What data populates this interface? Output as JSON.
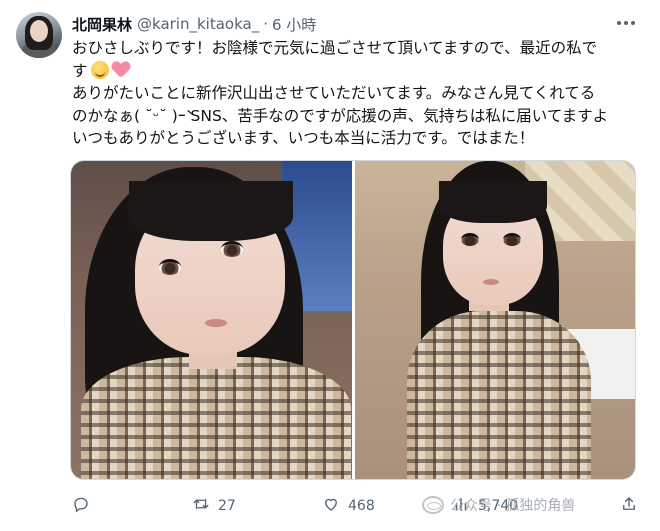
{
  "author": {
    "display_name": "北岡果林",
    "handle": "@karin_kitaoka_",
    "separator": "·",
    "time": "6 小時"
  },
  "tweet": {
    "lines": [
      "おひさしぶりです！お陰様で元気に過ごさせて頂いてますので、最近の私で",
      "す",
      "ありがたいことに新作沢山出させていただいてます。みなさん見てくれてる",
      "のかなぁ( ˘ᵕ˘ )ｰ̀ SNS、苦手なのですが応援の声、気持ちは私に届いてますよ",
      "いつもありがとうございます、いつも本当に活力です。ではまた！"
    ],
    "emojis": [
      "relieved-face-emoji",
      "pink-heart-emoji"
    ]
  },
  "media": {
    "photos": [
      "photo-left",
      "photo-right"
    ]
  },
  "actions": {
    "reply_count": "",
    "retweet_count": "27",
    "like_count": "468",
    "views_count": "5,740"
  },
  "watermark": {
    "text": "公众号 · 孤独的角兽"
  },
  "icons": {
    "reply": "reply-icon",
    "retweet": "retweet-icon",
    "like": "heart-icon",
    "views": "views-chart-icon",
    "share": "share-icon",
    "more": "more-icon"
  },
  "colors": {
    "text": "#0f1419",
    "muted": "#536471",
    "border": "#cfd9de"
  }
}
